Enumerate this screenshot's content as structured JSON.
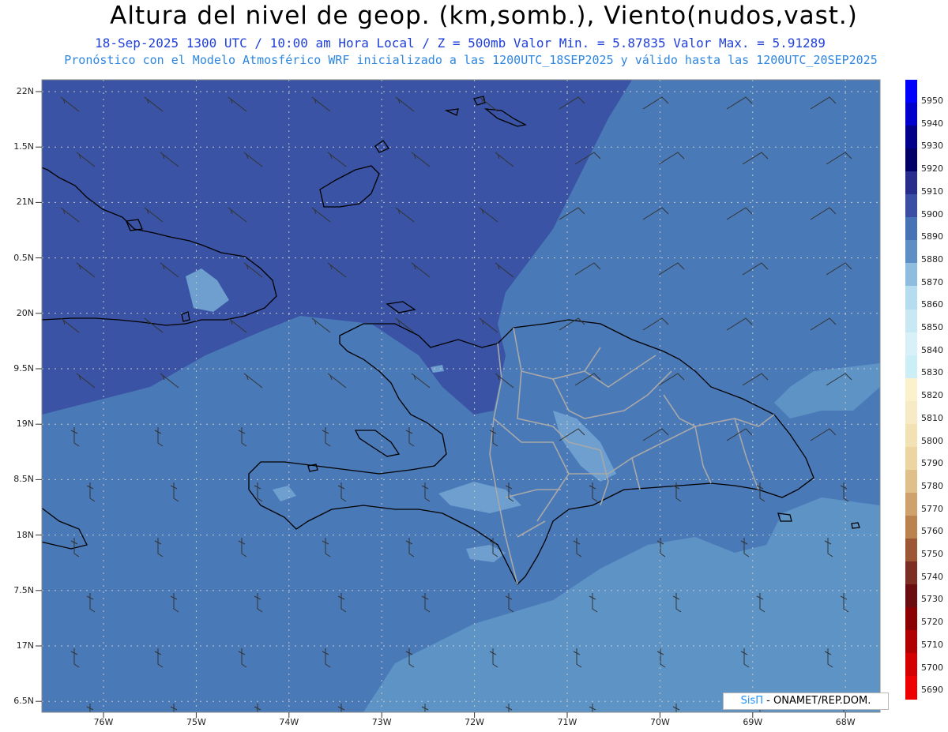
{
  "header": {
    "title": "Altura del nivel de geop. (km,somb.), Viento(nudos,vast.)",
    "subtitle": "18-Sep-2025  1300 UTC / 10:00 am Hora Local / Z = 500mb   Valor Min. = 5.87835  Valor Max. = 5.91289",
    "subtitle2": "Pronóstico con el Modelo Atmosférico WRF inicializado a las 1200UTC_18SEP2025 y válido hasta las  1200UTC_20SEP2025"
  },
  "axes": {
    "lat_labels": [
      "22N",
      "1.5N",
      "21N",
      "0.5N",
      "20N",
      "9.5N",
      "19N",
      "8.5N",
      "18N",
      "7.5N",
      "17N",
      "6.5N"
    ],
    "lon_labels": [
      "76W",
      "75W",
      "74W",
      "73W",
      "72W",
      "71W",
      "70W",
      "69W",
      "68W"
    ]
  },
  "colorbar": {
    "labels": [
      "5950",
      "5940",
      "5930",
      "5920",
      "5910",
      "5900",
      "5890",
      "5880",
      "5870",
      "5860",
      "5850",
      "5840",
      "5830",
      "5820",
      "5810",
      "5800",
      "5790",
      "5780",
      "5770",
      "5760",
      "5750",
      "5740",
      "5730",
      "5720",
      "5710",
      "5700",
      "5690"
    ],
    "colors": [
      "#0000ff",
      "#0000cd",
      "#00008b",
      "#000066",
      "#272d8c",
      "#3a4ea3",
      "#4573b6",
      "#5d8fc4",
      "#8fbde0",
      "#b5dcef",
      "#c8e8f4",
      "#d8f0f8",
      "#cceef6",
      "#fbf1cc",
      "#f6ebc6",
      "#f2e1b3",
      "#ecd5a0",
      "#e0c08a",
      "#cfa16c",
      "#b9824f",
      "#9d5735",
      "#7d2e22",
      "#6a0c10",
      "#8b0000",
      "#b00000",
      "#d40000",
      "#ee0000"
    ]
  },
  "map_colors": {
    "ocean_dark": "#3a53a4",
    "ocean_mid": "#4a79b7",
    "ocean_light": "#5e93c6",
    "patch_light": "#6e9fcf",
    "coast": "#000000",
    "province": "#a8a8a8"
  },
  "credit": {
    "sis": "SisΠ",
    "rest": " - ONAMET/REP.DOM."
  }
}
